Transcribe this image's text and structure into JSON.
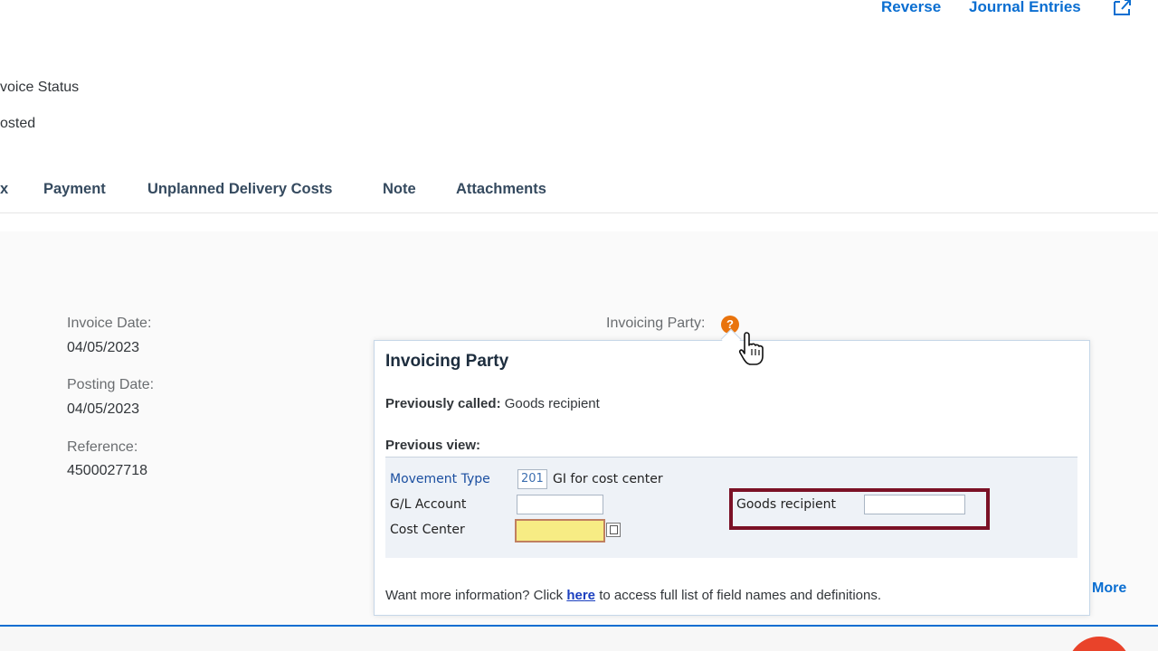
{
  "header": {
    "actions": {
      "reverse": "Reverse",
      "journal_entries": "Journal Entries"
    },
    "status_label": "voice Status",
    "status_value": "osted"
  },
  "tabs": [
    "x",
    "Payment",
    "Unplanned Delivery Costs",
    "Note",
    "Attachments"
  ],
  "fields": {
    "invoice_date_label": "Invoice Date:",
    "invoice_date_value": "04/05/2023",
    "posting_date_label": "Posting Date:",
    "posting_date_value": "04/05/2023",
    "reference_label": "Reference:",
    "reference_value": "4500027718",
    "invoicing_party_label": "Invoicing Party:"
  },
  "help_icon_glyph": "?",
  "more_link": "More",
  "popover": {
    "title": "Invoicing Party",
    "previously_called_label": "Previously called:",
    "previously_called_value": "Goods recipient",
    "previous_view_label": "Previous view:",
    "gui": {
      "movement_type_label": "Movement Type",
      "movement_type_code": "201",
      "movement_type_text": "GI for cost center",
      "gl_account_label": "G/L Account",
      "cost_center_label": "Cost Center",
      "goods_recipient_label": "Goods recipient"
    },
    "footer_prefix": "Want more information? Click",
    "footer_link": "here",
    "footer_suffix": "to access full list of field names and definitions."
  },
  "colors": {
    "link": "#0a6ed1",
    "help_icon": "#e9730c",
    "highlight_border": "#7b1126",
    "required_field": "#f7ec84"
  }
}
